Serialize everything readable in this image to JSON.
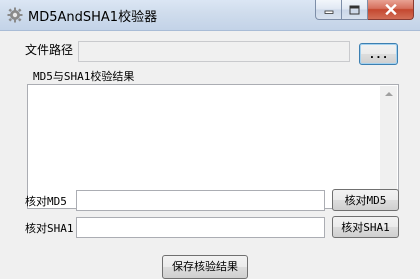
{
  "window": {
    "title": "MD5AndSHA1校验器",
    "icon": "gear-icon",
    "buttons": {
      "minimize": "minimize-icon",
      "maximize": "maximize-icon",
      "close": "close-icon"
    }
  },
  "file_path": {
    "label": "文件路径",
    "value": "",
    "browse_label": "..."
  },
  "result": {
    "label": "MD5与SHA1校验结果",
    "text": ""
  },
  "md5": {
    "label": "核对MD5",
    "value": "",
    "button_label": "核对MD5"
  },
  "sha1": {
    "label": "核对SHA1",
    "value": "",
    "button_label": "核对SHA1"
  },
  "save": {
    "button_label": "保存核验结果"
  }
}
